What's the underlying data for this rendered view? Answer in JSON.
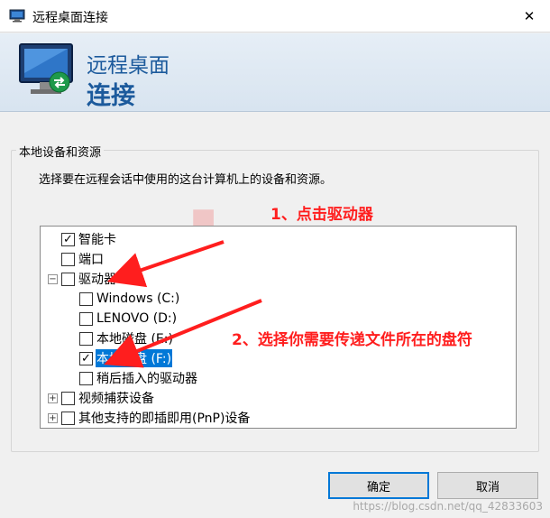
{
  "window": {
    "title": "远程桌面连接",
    "close_glyph": "✕"
  },
  "banner": {
    "line1": "远程桌面",
    "line2": "连接"
  },
  "group": {
    "label": "本地设备和资源",
    "instruction": "选择要在远程会话中使用的这台计算机上的设备和资源。"
  },
  "tree": {
    "smartcard": {
      "label": "智能卡",
      "checked": true
    },
    "ports": {
      "label": "端口",
      "checked": false
    },
    "drives": {
      "label": "驱动器",
      "checked": false,
      "expanded": true,
      "children": [
        {
          "label": "Windows (C:)",
          "checked": false
        },
        {
          "label": "LENOVO (D:)",
          "checked": false
        },
        {
          "label": "本地磁盘 (E:)",
          "checked": false
        },
        {
          "label": "本地磁盘 (F:)",
          "checked": true,
          "selected": true
        },
        {
          "label": "稍后插入的驱动器",
          "checked": false
        }
      ]
    },
    "video": {
      "label": "视频捕获设备",
      "checked": false,
      "expanded": false
    },
    "pnp": {
      "label": "其他支持的即插即用(PnP)设备",
      "checked": false,
      "expanded": false
    }
  },
  "annotations": {
    "step1": "1、点击驱动器",
    "step2": "2、选择你需要传递文件所在的盘符",
    "watermark": "obge",
    "color": "#ff1e1e"
  },
  "buttons": {
    "ok": "确定",
    "cancel": "取消"
  },
  "footer_watermark": "https://blog.csdn.net/qq_42833603",
  "icons": {
    "app": "remote-desktop-icon",
    "close": "close-icon",
    "expander_minus": "⊟",
    "expander_plus": "⊞"
  }
}
